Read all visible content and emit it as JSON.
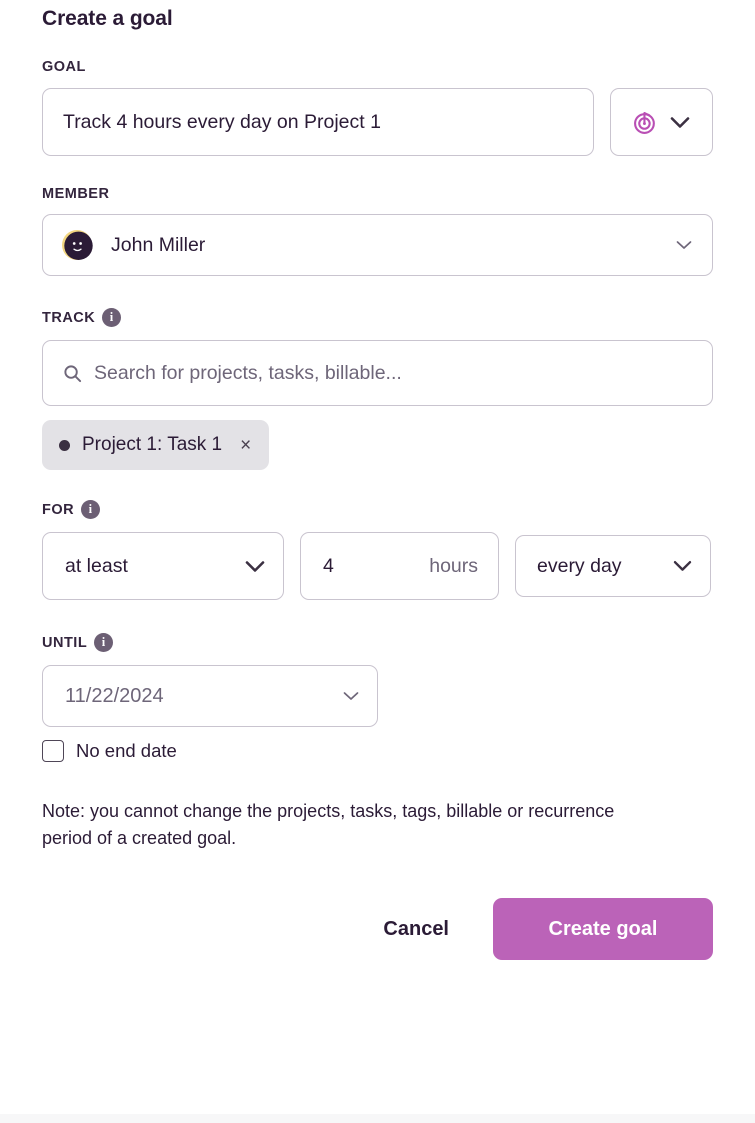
{
  "modal": {
    "title": "Create a goal",
    "note": "Note: you cannot change the projects, tasks, tags, billable or recurrence period of a created goal."
  },
  "goal": {
    "label": "GOAL",
    "value": "Track 4 hours every day on Project 1",
    "placeholder": "",
    "type_icon": "target-icon"
  },
  "member": {
    "label": "MEMBER",
    "selected": "John Miller",
    "avatar_icon": "avatar-face-icon"
  },
  "track": {
    "label": "TRACK",
    "info_glyph": "i",
    "search_placeholder": "Search for projects, tasks, billable...",
    "search_value": "",
    "search_icon": "search-icon",
    "chips": [
      {
        "label": "Project 1: Task 1",
        "dot_color": "#3b3042",
        "remove_glyph": "×"
      }
    ]
  },
  "for": {
    "label": "FOR",
    "info_glyph": "i",
    "comparator": "at least",
    "amount": "4",
    "unit": "hours",
    "recurrence": "every day"
  },
  "until": {
    "label": "UNTIL",
    "info_glyph": "i",
    "date": "11/22/2024",
    "no_end_date_label": "No end date",
    "no_end_date_checked": false
  },
  "footer": {
    "cancel_label": "Cancel",
    "create_label": "Create goal"
  },
  "colors": {
    "accent": "#bb63b8",
    "text": "#2b1b36",
    "muted": "#6e6679",
    "border": "#c9c4cf",
    "chip_bg": "#e3e2e6",
    "info_bg": "#6c5f74"
  }
}
